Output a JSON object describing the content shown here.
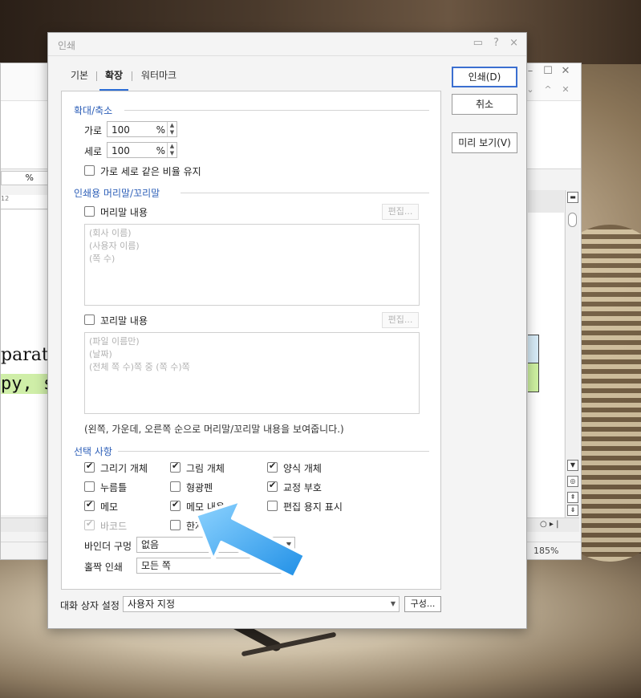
{
  "editor": {
    "zoom_unit": "%",
    "ruler_mark": "12",
    "doc_line1": "parat",
    "doc_line2": "py, s",
    "zoom_level": "185%"
  },
  "dialog": {
    "title": "인쇄",
    "title_buttons": {
      "help": "?",
      "close": "×",
      "chat": "▭"
    },
    "tabs": [
      {
        "label": "기본",
        "active": false
      },
      {
        "label": "확장",
        "active": true
      },
      {
        "label": "워터마크",
        "active": false
      }
    ],
    "scale": {
      "title": "확대/축소",
      "horizontal_label": "가로",
      "horizontal_value": "100",
      "vertical_label": "세로",
      "vertical_value": "100",
      "unit": "%",
      "keep_ratio_label": "가로 세로 같은 비율 유지",
      "keep_ratio_checked": false
    },
    "header_footer": {
      "title": "인쇄용 머리말/꼬리말",
      "header_label": "머리말 내용",
      "header_checked": false,
      "header_edit": "편집...",
      "header_lines": [
        "(회사 이름)",
        "(사용자 이름)",
        "(쪽 수)"
      ],
      "footer_label": "꼬리말 내용",
      "footer_checked": false,
      "footer_edit": "편집...",
      "footer_lines": [
        "(파일 이름만)",
        "(날짜)",
        "(전체 쪽 수)쪽 중 (쪽 수)쪽"
      ],
      "note": "(왼쪽, 가운데, 오른쪽 순으로 머리말/꼬리말 내용을 보여줍니다.)"
    },
    "options": {
      "title": "선택 사항",
      "items": [
        {
          "label": "그리기 개체",
          "checked": true,
          "disabled": false
        },
        {
          "label": "그림 개체",
          "checked": true,
          "disabled": false
        },
        {
          "label": "양식 개체",
          "checked": true,
          "disabled": false
        },
        {
          "label": "누름틀",
          "checked": false,
          "disabled": false
        },
        {
          "label": "형광펜",
          "checked": false,
          "disabled": false
        },
        {
          "label": "교정 부호",
          "checked": true,
          "disabled": false
        },
        {
          "label": "메모",
          "checked": true,
          "disabled": false
        },
        {
          "label": "메모 내용",
          "checked": true,
          "disabled": false
        },
        {
          "label": "편집 용지 표시",
          "checked": false,
          "disabled": false
        },
        {
          "label": "바코드",
          "checked": true,
          "disabled": true
        },
        {
          "label": "한자",
          "checked": false,
          "disabled": false
        }
      ],
      "binder_label": "바인더 구멍",
      "binder_value": "없음",
      "oddeven_label": "홀짝 인쇄",
      "oddeven_value": "모든 쪽"
    },
    "dialog_setting_label": "대화 상자 설정",
    "dialog_setting_value": "사용자 지정",
    "config_button": "구성...",
    "buttons": {
      "print": "인쇄(D)",
      "cancel": "취소",
      "preview": "미리 보기(V)"
    }
  },
  "colors": {
    "accent": "#2b6cd6",
    "section_title": "#2d5fb8",
    "arrow": "#35a8f0"
  }
}
